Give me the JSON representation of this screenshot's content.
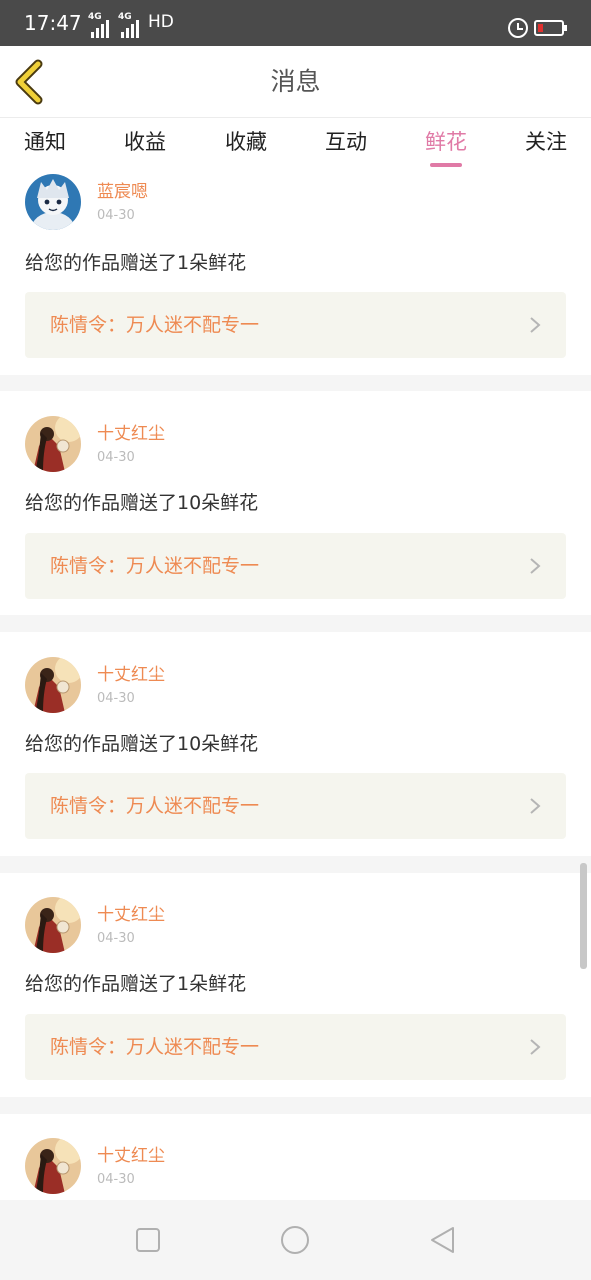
{
  "status_bar": {
    "time": "17:47",
    "network_1": "4G",
    "network_2": "4G",
    "hd": "HD",
    "icons": [
      "alarm-icon",
      "battery-icon"
    ],
    "battery_color": "#e0312f"
  },
  "header": {
    "title": "消息",
    "back_icon": "chevron-left-icon",
    "back_color": "#f0d038"
  },
  "tabs": [
    {
      "label": "通知",
      "active": false
    },
    {
      "label": "收益",
      "active": false
    },
    {
      "label": "收藏",
      "active": false
    },
    {
      "label": "互动",
      "active": false
    },
    {
      "label": "鲜花",
      "active": true
    },
    {
      "label": "关注",
      "active": false
    }
  ],
  "colors": {
    "accent_pink": "#e07aa6",
    "username_orange": "#ee8a52",
    "link_background": "#f5f5ee"
  },
  "messages": [
    {
      "username": "蓝宸嗯",
      "date": "04-30",
      "text": "给您的作品赠送了1朵鲜花",
      "work_title": "陈情令：万人迷不配专一",
      "avatar": "anime-avatar"
    },
    {
      "username": "十丈红尘",
      "date": "04-30",
      "text": "给您的作品赠送了10朵鲜花",
      "work_title": "陈情令：万人迷不配专一",
      "avatar": "ancient-style-avatar"
    },
    {
      "username": "十丈红尘",
      "date": "04-30",
      "text": "给您的作品赠送了10朵鲜花",
      "work_title": "陈情令：万人迷不配专一",
      "avatar": "ancient-style-avatar"
    },
    {
      "username": "十丈红尘",
      "date": "04-30",
      "text": "给您的作品赠送了1朵鲜花",
      "work_title": "陈情令：万人迷不配专一",
      "avatar": "ancient-style-avatar"
    },
    {
      "username": "十丈红尘",
      "date": "04-30",
      "avatar": "ancient-style-avatar"
    }
  ],
  "nav_bar": {
    "icons": [
      "recent-apps-icon",
      "home-icon",
      "back-triangle-icon"
    ]
  }
}
